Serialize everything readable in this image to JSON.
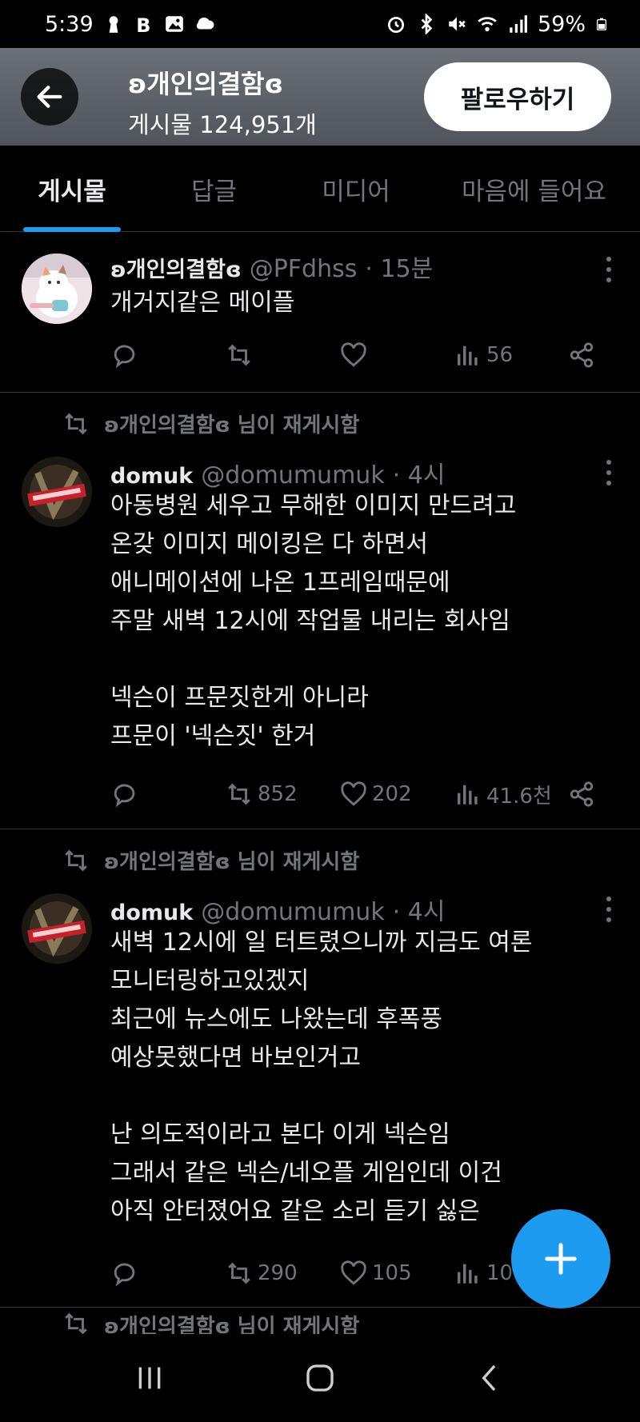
{
  "status_bar": {
    "time": "5:39",
    "battery": "59%",
    "left_icons": [
      "keyhole-icon",
      "b-icon",
      "gallery-icon",
      "cloud-icon"
    ],
    "right_icons": [
      "alarm-icon",
      "bluetooth-icon",
      "mute-icon",
      "wifi-icon",
      "signal-icon",
      "battery-icon"
    ]
  },
  "header": {
    "name": "ʚ개인의결함ɞ",
    "post_count": "게시물 124,951개",
    "follow_label": "팔로우하기"
  },
  "tabs": [
    {
      "label": "게시물",
      "active": true
    },
    {
      "label": "답글",
      "active": false
    },
    {
      "label": "미디어",
      "active": false
    },
    {
      "label": "마음에 들어요",
      "active": false
    }
  ],
  "tweets": [
    {
      "retweeted_by": "",
      "name": "ʚ개인의결함ɞ",
      "handle": "@PFdhss",
      "time": "· 15분",
      "text": "개거지같은 메이플",
      "replies": "",
      "retweets": "",
      "likes": "",
      "views": "56"
    },
    {
      "retweeted_by": "ʚ개인의결함ɞ 님이 재게시함",
      "name": "domuk",
      "handle": "@domumumuk",
      "time": "· 4시",
      "text": "아동병원 세우고 무해한 이미지 만드려고\n온갖 이미지 메이킹은 다 하면서\n애니메이션에 나온 1프레임때문에\n주말 새벽 12시에 작업물 내리는 회사임\n\n넥슨이 프문짓한게 아니라\n프문이 '넥슨짓' 한거",
      "replies": "",
      "retweets": "852",
      "likes": "202",
      "views": "41.6천"
    },
    {
      "retweeted_by": "ʚ개인의결함ɞ 님이 재게시함",
      "name": "domuk",
      "handle": "@domumumuk",
      "time": "· 4시",
      "text": "새벽 12시에 일 터트렸으니까 지금도 여론\n모니터링하고있겠지\n최근에 뉴스에도 나왔는데 후폭풍\n예상못했다면 바보인거고\n\n난 의도적이라고 본다 이게 넥슨임\n그래서 같은 넥슨/네오플 게임인데 이건\n아직 안터졌어요 같은 소리 듣기 싫은",
      "replies": "",
      "retweets": "290",
      "likes": "105",
      "views": "10"
    }
  ],
  "peek": {
    "retweeted_by": "ʚ개인의결함ɞ 님이 재게시함"
  },
  "colors": {
    "accent": "#1d9bf0",
    "background": "#000000",
    "muted": "#71767b",
    "text": "#e7e9ea"
  }
}
